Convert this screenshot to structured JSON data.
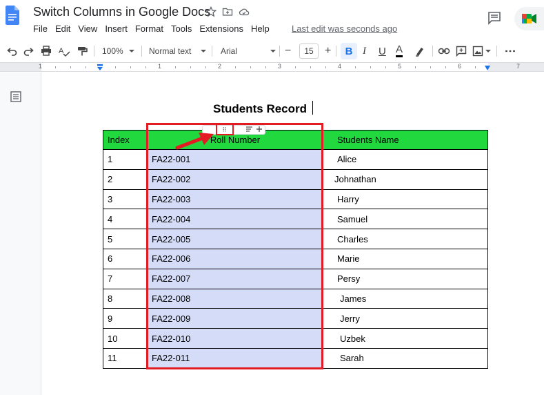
{
  "window": {
    "title": "Switch Columns in Google Docs",
    "menu": [
      "File",
      "Edit",
      "View",
      "Insert",
      "Format",
      "Tools",
      "Extensions",
      "Help"
    ],
    "last_edit": "Last edit was seconds ago"
  },
  "toolbar": {
    "zoom": "100%",
    "style": "Normal text",
    "font": "Arial",
    "font_size": "15",
    "bold": "B",
    "italic": "I",
    "underline": "U",
    "text_color": "A",
    "more": "⋮"
  },
  "ruler": {
    "numbers": [
      "1",
      "1",
      "2",
      "3",
      "4",
      "5",
      "6",
      "7"
    ]
  },
  "document": {
    "heading": "Students Record",
    "table": {
      "headers": [
        "Index",
        "Roll Number",
        "Students Name"
      ],
      "rows": [
        [
          "1",
          "FA22-001",
          "Alice"
        ],
        [
          "2",
          "FA22-002",
          "Johnathan"
        ],
        [
          "3",
          "FA22-003",
          "Harry"
        ],
        [
          "4",
          "FA22-004",
          "Samuel"
        ],
        [
          "5",
          "FA22-005",
          "Charles"
        ],
        [
          "6",
          "FA22-006",
          "Marie"
        ],
        [
          "7",
          "FA22-007",
          "Persy"
        ],
        [
          "8",
          "FA22-008",
          "James"
        ],
        [
          "9",
          "FA22-009",
          "Jerry"
        ],
        [
          "10",
          "FA22-010",
          "Uzbek"
        ],
        [
          "11",
          "FA22-011",
          "Sarah"
        ]
      ]
    }
  },
  "colors": {
    "header_green": "#21d83f",
    "selected_column": "#d4dcf7",
    "annotation_red": "#e41b23",
    "accent_blue": "#1a73e8"
  }
}
